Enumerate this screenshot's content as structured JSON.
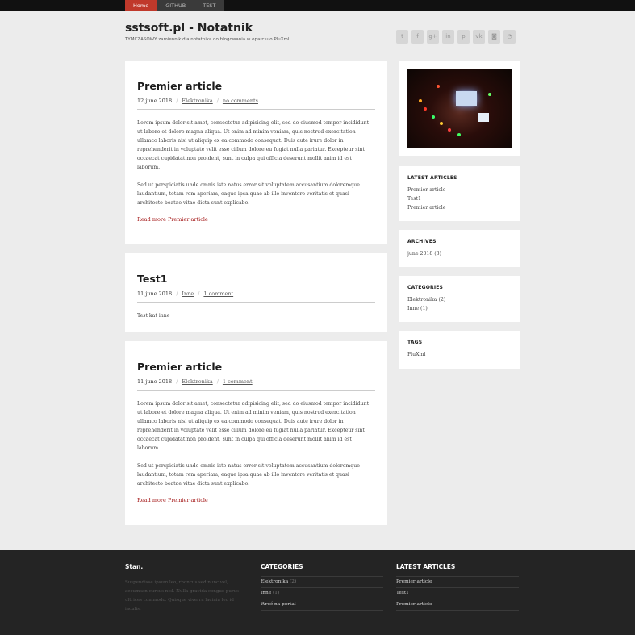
{
  "nav": {
    "items": [
      "Home",
      "GITHUB",
      "TEST"
    ]
  },
  "header": {
    "title": "sstsoft.pl - Notatnik",
    "subtitle": "TYMCZASOWY zamiennik dla notatnika do blogowania w oparciu o PluXml"
  },
  "social": [
    "twitter-icon",
    "facebook-icon",
    "google-plus-icon",
    "linkedin-icon",
    "pinterest-icon",
    "vk-icon",
    "instagram-icon",
    "rss-icon"
  ],
  "social_glyphs": [
    "t",
    "f",
    "g+",
    "in",
    "p",
    "vk",
    "◙",
    "◔"
  ],
  "posts": [
    {
      "title": "Premier article",
      "date": "12 june 2018",
      "category": "Elektronika",
      "comments": "no comments",
      "paragraphs": [
        "Lorem ipsum dolor sit amet, consectetur adipisicing elit, sed do eiusmod tempor incididunt ut labore et dolore magna aliqua. Ut enim ad minim veniam, quis nostrud exercitation ullamco laboris nisi ut aliquip ex ea commodo consequat. Duis aute irure dolor in reprehenderit in voluptate velit esse cillum dolore eu fugiat nulla pariatur. Excepteur sint occaecat cupidatat non proident, sunt in culpa qui officia deserunt mollit anim id est laborum.",
        "Sed ut perspiciatis unde omnis iste natus error sit voluptatem accusantium doloremque laudantium, totam rem aperiam, eaque ipsa quae ab illo inventore veritatis et quasi architecto beatae vitae dicta sunt explicabo."
      ],
      "more": "Read more Premier article"
    },
    {
      "title": "Test1",
      "date": "11 june 2018",
      "category": "Inne",
      "comments": "1 comment",
      "paragraphs": [
        "Test kat inne"
      ]
    },
    {
      "title": "Premier article",
      "date": "11 june 2018",
      "category": "Elektronika",
      "comments": "1 comment",
      "paragraphs": [
        "Lorem ipsum dolor sit amet, consectetur adipisicing elit, sed do eiusmod tempor incididunt ut labore et dolore magna aliqua. Ut enim ad minim veniam, quis nostrud exercitation ullamco laboris nisi ut aliquip ex ea commodo consequat. Duis aute irure dolor in reprehenderit in voluptate velit esse cillum dolore eu fugiat nulla pariatur. Excepteur sint occaecat cupidatat non proident, sunt in culpa qui officia deserunt mollit anim id est laborum.",
        "Sed ut perspiciatis unde omnis iste natus error sit voluptatem accusantium doloremque laudantium, totam rem aperiam, eaque ipsa quae ab illo inventore veritatis et quasi architecto beatae vitae dicta sunt explicabo."
      ],
      "more": "Read more Premier article"
    }
  ],
  "sidebar": {
    "latest": {
      "title": "LATEST ARTICLES",
      "items": [
        "Premier article",
        "Test1",
        "Premier article"
      ]
    },
    "archives": {
      "title": "ARCHIVES",
      "items": [
        "june 2018 (3)"
      ]
    },
    "categories": {
      "title": "CATEGORIES",
      "items": [
        "Elektronika (2)",
        "Inne (1)"
      ]
    },
    "tags": {
      "title": "TAGS",
      "items": [
        "PluXml"
      ]
    }
  },
  "footer": {
    "about": {
      "title": "Stan.",
      "text": "Suspendisse ipsum leo, rhoncus sed nunc vel, accumsan cursus nisl. Nulla gravida congue purus ultrices commodo. Quisque viverra lacinia leo id iaculis."
    },
    "categories": {
      "title": "CATEGORIES",
      "rows": [
        {
          "label": "Elektronika",
          "count": "(2)"
        },
        {
          "label": "Inne",
          "count": "(1)"
        },
        {
          "label": "Wróć na portal",
          "count": ""
        }
      ]
    },
    "latest": {
      "title": "LATEST ARTICLES",
      "rows": [
        "Premier article",
        "Test1",
        "Premier article"
      ]
    }
  },
  "colors": {
    "accent": "#c0392b",
    "link": "#a31515",
    "footer_bg": "#242424"
  }
}
